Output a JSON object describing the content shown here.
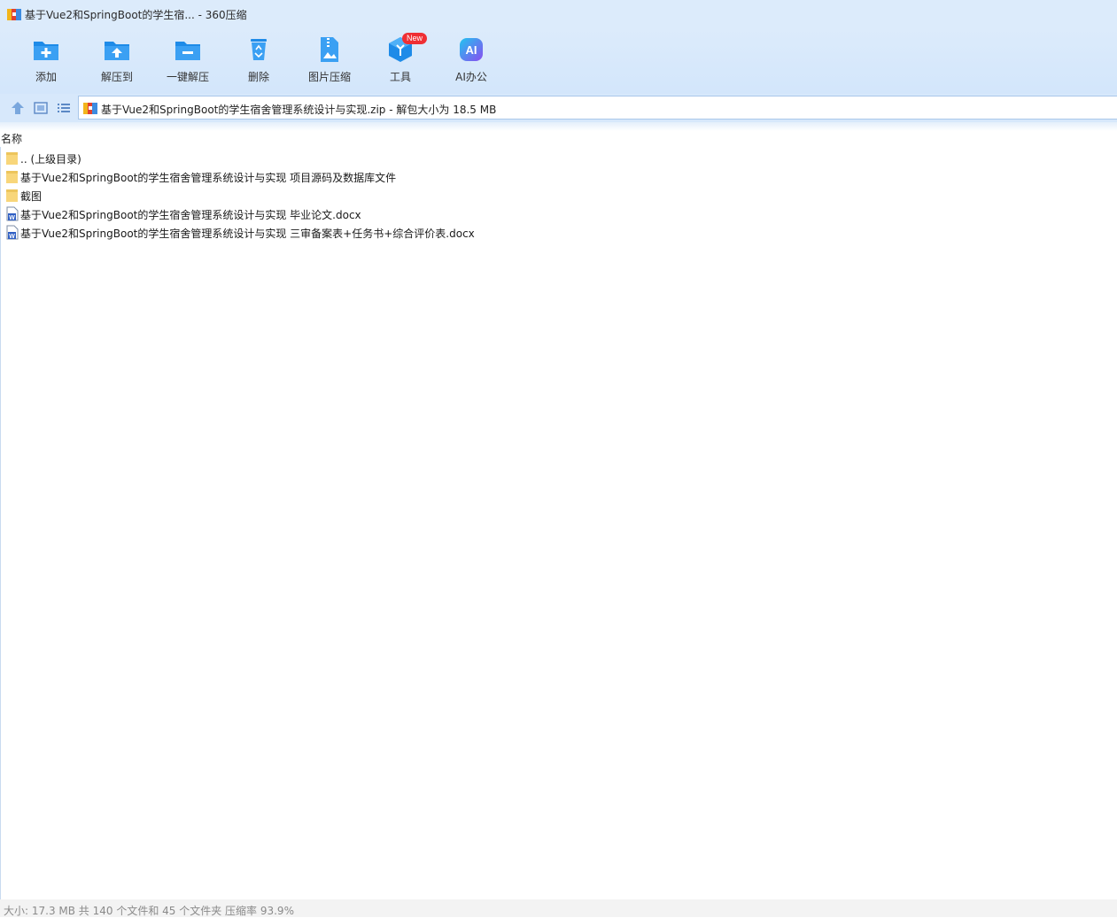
{
  "window": {
    "title": "基于Vue2和SpringBoot的学生宿... - 360压缩"
  },
  "toolbar": {
    "buttons": [
      {
        "label": "添加",
        "icon": "folder-add-icon"
      },
      {
        "label": "解压到",
        "icon": "folder-extract-icon"
      },
      {
        "label": "一键解压",
        "icon": "folder-oneclick-extract-icon"
      },
      {
        "label": "删除",
        "icon": "recycle-bin-icon"
      },
      {
        "label": "图片压缩",
        "icon": "image-compress-icon"
      },
      {
        "label": "工具",
        "icon": "tools-cube-icon",
        "badge": "New"
      },
      {
        "label": "AI办公",
        "icon": "ai-office-icon"
      }
    ]
  },
  "address": {
    "path": "基于Vue2和SpringBoot的学生宿舍管理系统设计与实现.zip - 解包大小为 18.5 MB"
  },
  "list": {
    "column_name": "名称",
    "rows": [
      {
        "name": ".. (上级目录)",
        "type": "folder"
      },
      {
        "name": "基于Vue2和SpringBoot的学生宿舍管理系统设计与实现 项目源码及数据库文件",
        "type": "folder"
      },
      {
        "name": "截图",
        "type": "folder"
      },
      {
        "name": "基于Vue2和SpringBoot的学生宿舍管理系统设计与实现 毕业论文.docx",
        "type": "word"
      },
      {
        "name": "基于Vue2和SpringBoot的学生宿舍管理系统设计与实现 三审备案表+任务书+综合评价表.docx",
        "type": "word"
      }
    ]
  },
  "status": {
    "text": "大小: 17.3 MB 共 140 个文件和 45 个文件夹 压缩率 93.9%"
  },
  "colors": {
    "accent": "#1e8be8",
    "toolbar_bg": "#dcebfb",
    "badge": "#ef2f34"
  }
}
